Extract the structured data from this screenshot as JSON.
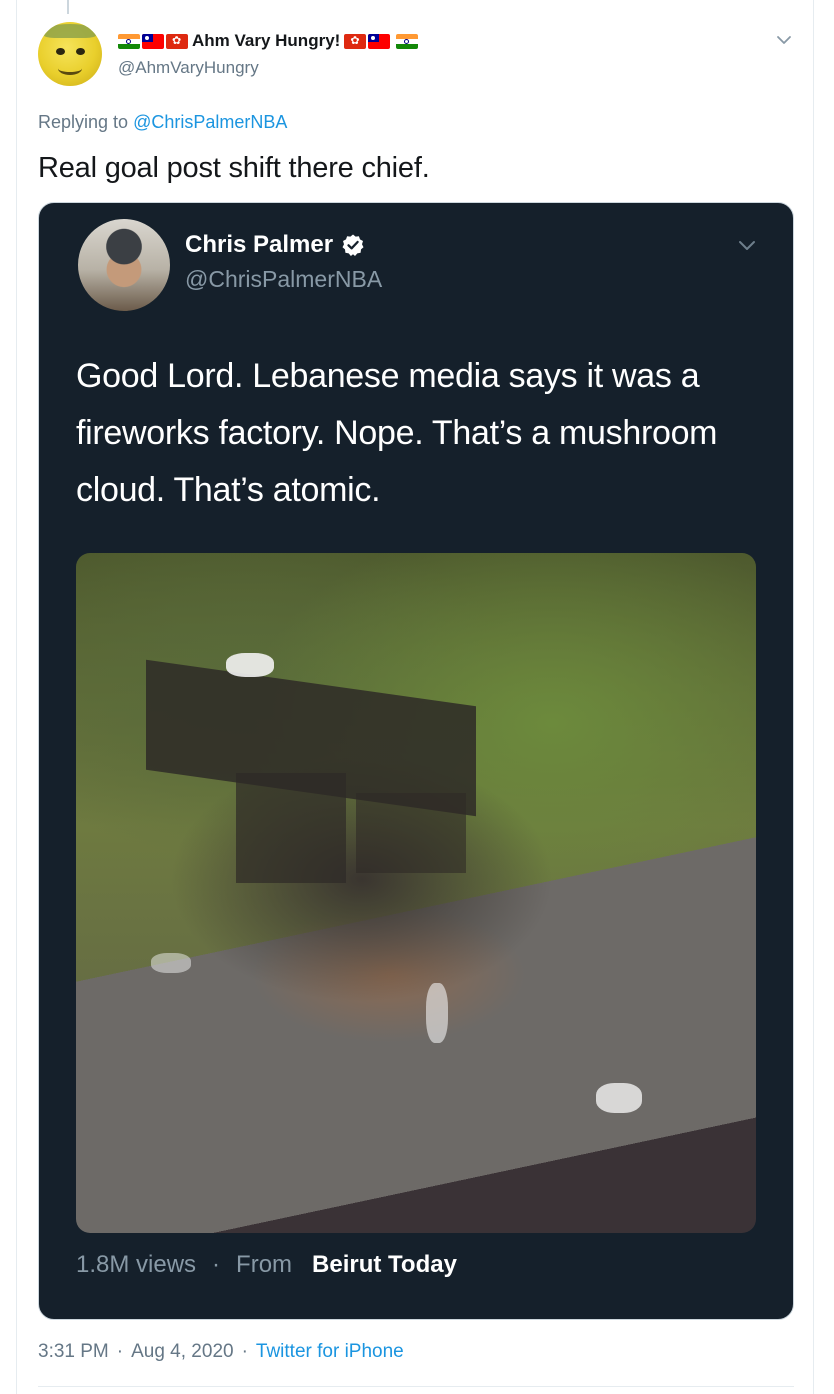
{
  "reply": {
    "display_name": "Ahm Vary Hungry!",
    "handle": "@AhmVaryHungry",
    "replying_prefix": "Replying to",
    "replying_mention": "@ChrisPalmerNBA",
    "text": "Real goal post shift there chief.",
    "timestamp_time": "3:31 PM",
    "timestamp_date": "Aug 4, 2020",
    "client": "Twitter for iPhone",
    "separator": "·",
    "flags_left": [
      "india-flag",
      "taiwan-flag",
      "hong-kong-flag"
    ],
    "flags_right": [
      "hong-kong-flag",
      "taiwan-flag",
      "india-flag"
    ]
  },
  "quoted": {
    "display_name": "Chris Palmer",
    "handle": "@ChrisPalmerNBA",
    "verified": true,
    "text": "Good Lord. Lebanese media says it was a fireworks factory. Nope. That’s a mushroom cloud. That’s atomic.",
    "views": "1.8M views",
    "separator": "·",
    "from_label": "From",
    "source": "Beirut Today"
  },
  "colors": {
    "link": "#1b95e0",
    "dark_bg": "#15202b",
    "muted": "#657786"
  }
}
